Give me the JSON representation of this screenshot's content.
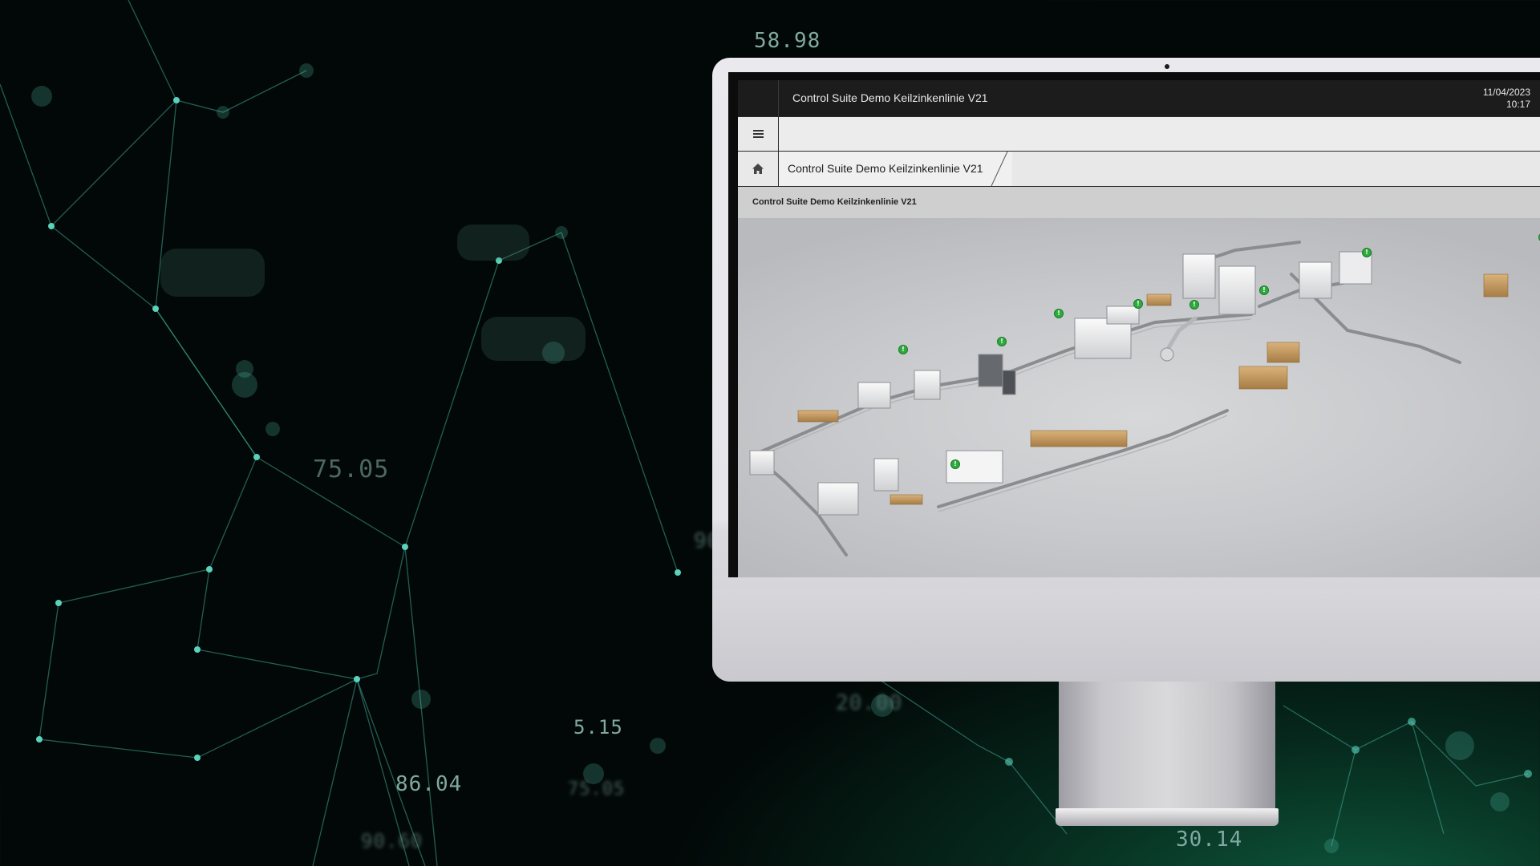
{
  "background": {
    "numbers": [
      "58.98",
      "75.05",
      "5.15",
      "86.04",
      "75.05",
      "90.60",
      "30.14",
      "20.00",
      "90.00"
    ],
    "accent_color": "#57c7b4"
  },
  "app": {
    "title": "Control Suite Demo Keilzinkenlinie V21",
    "date": "11/04/2023",
    "time": "10:17",
    "menu_icon": "hamburger-icon",
    "home_icon": "home-icon",
    "breadcrumb": [
      "Control Suite Demo Keilzinkenlinie V21"
    ],
    "page_title": "Control Suite Demo Keilzinkenlinie V21",
    "status_icon": "info-icon",
    "status_color": "#2faa3e",
    "status_glyph": "!"
  }
}
